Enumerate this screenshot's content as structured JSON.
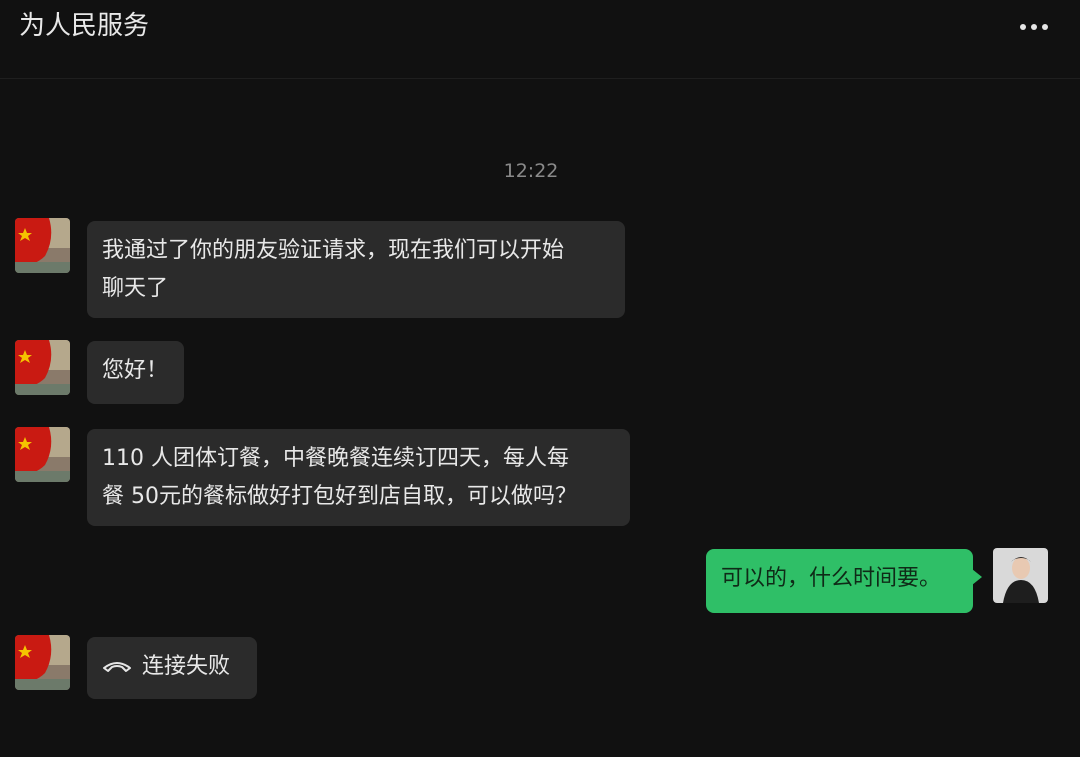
{
  "header": {
    "title": "为人民服务",
    "more_icon": "more-dots-icon"
  },
  "timestamp": "12:22",
  "colors": {
    "background": "#111111",
    "incoming_bubble": "#2b2b2b",
    "outgoing_bubble": "#2fbf67"
  },
  "messages": [
    {
      "from": "contact",
      "lines": [
        "我通过了你的朋友验证请求，现在我们可以开始",
        "聊天了"
      ]
    },
    {
      "from": "contact",
      "lines": [
        "您好！"
      ]
    },
    {
      "from": "contact",
      "lines": [
        "110 人团体订餐，中餐晚餐连续订四天，每人每",
        "餐 50元的餐标做好打包好到店自取，可以做吗？"
      ]
    },
    {
      "from": "me",
      "lines": [
        "可以的，什么时间要。"
      ]
    },
    {
      "from": "contact",
      "type": "call",
      "icon": "phone-hangup-icon",
      "lines": [
        "连接失败"
      ]
    }
  ]
}
